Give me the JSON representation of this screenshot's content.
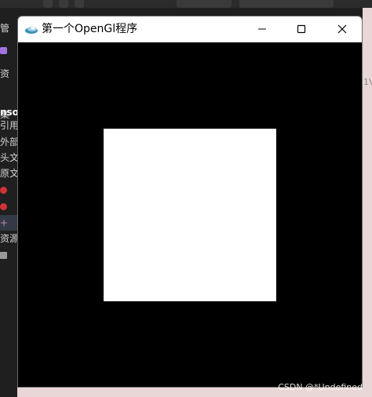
{
  "window": {
    "title": "第一个OpenGl程序"
  },
  "ide": {
    "sidebar_fragments": [
      "管",
      "资",
      "案 '",
      "nso",
      "引用",
      "外部",
      "头文",
      "原文",
      "",
      "",
      "+",
      "资源",
      ""
    ],
    "right_edge_text": "1V"
  },
  "watermark": {
    "text": "CSDN @*Undefined"
  },
  "colors": {
    "viewport_background": "#000000",
    "quad_fill": "#ffffff",
    "titlebar": "#ffffff",
    "ide_dark": "#1e1e1e"
  },
  "icons": {
    "app": "opengl-app-icon",
    "minimize": "minimize-icon",
    "maximize": "maximize-icon",
    "close": "close-icon"
  }
}
